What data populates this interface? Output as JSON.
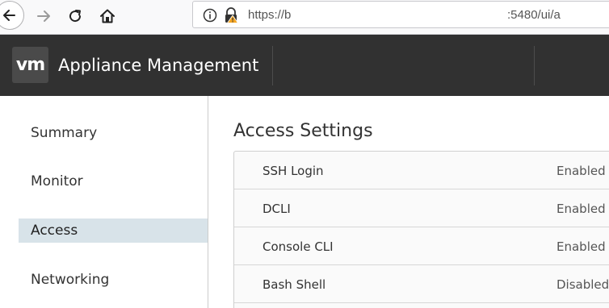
{
  "browser": {
    "url_prefix": "https://b",
    "url_suffix": ":5480/ui/a",
    "icons": [
      "back-arrow-icon",
      "forward-arrow-icon",
      "reload-icon",
      "home-icon",
      "info-icon",
      "lock-warning-icon"
    ]
  },
  "header": {
    "logo": "vm",
    "title": "Appliance Management"
  },
  "sidebar": {
    "items": [
      {
        "label": "Summary"
      },
      {
        "label": "Monitor"
      },
      {
        "label": "Access",
        "active": true
      },
      {
        "label": "Networking"
      }
    ]
  },
  "main": {
    "title": "Access Settings",
    "settings": [
      {
        "label": "SSH Login",
        "value": "Enabled"
      },
      {
        "label": "DCLI",
        "value": "Enabled"
      },
      {
        "label": "Console CLI",
        "value": "Enabled"
      },
      {
        "label": "Bash Shell",
        "value": "Disabled"
      }
    ]
  },
  "colors": {
    "header_bg": "#313131",
    "active_item_bg": "#d8e3e9",
    "warning": "#f5a623"
  }
}
